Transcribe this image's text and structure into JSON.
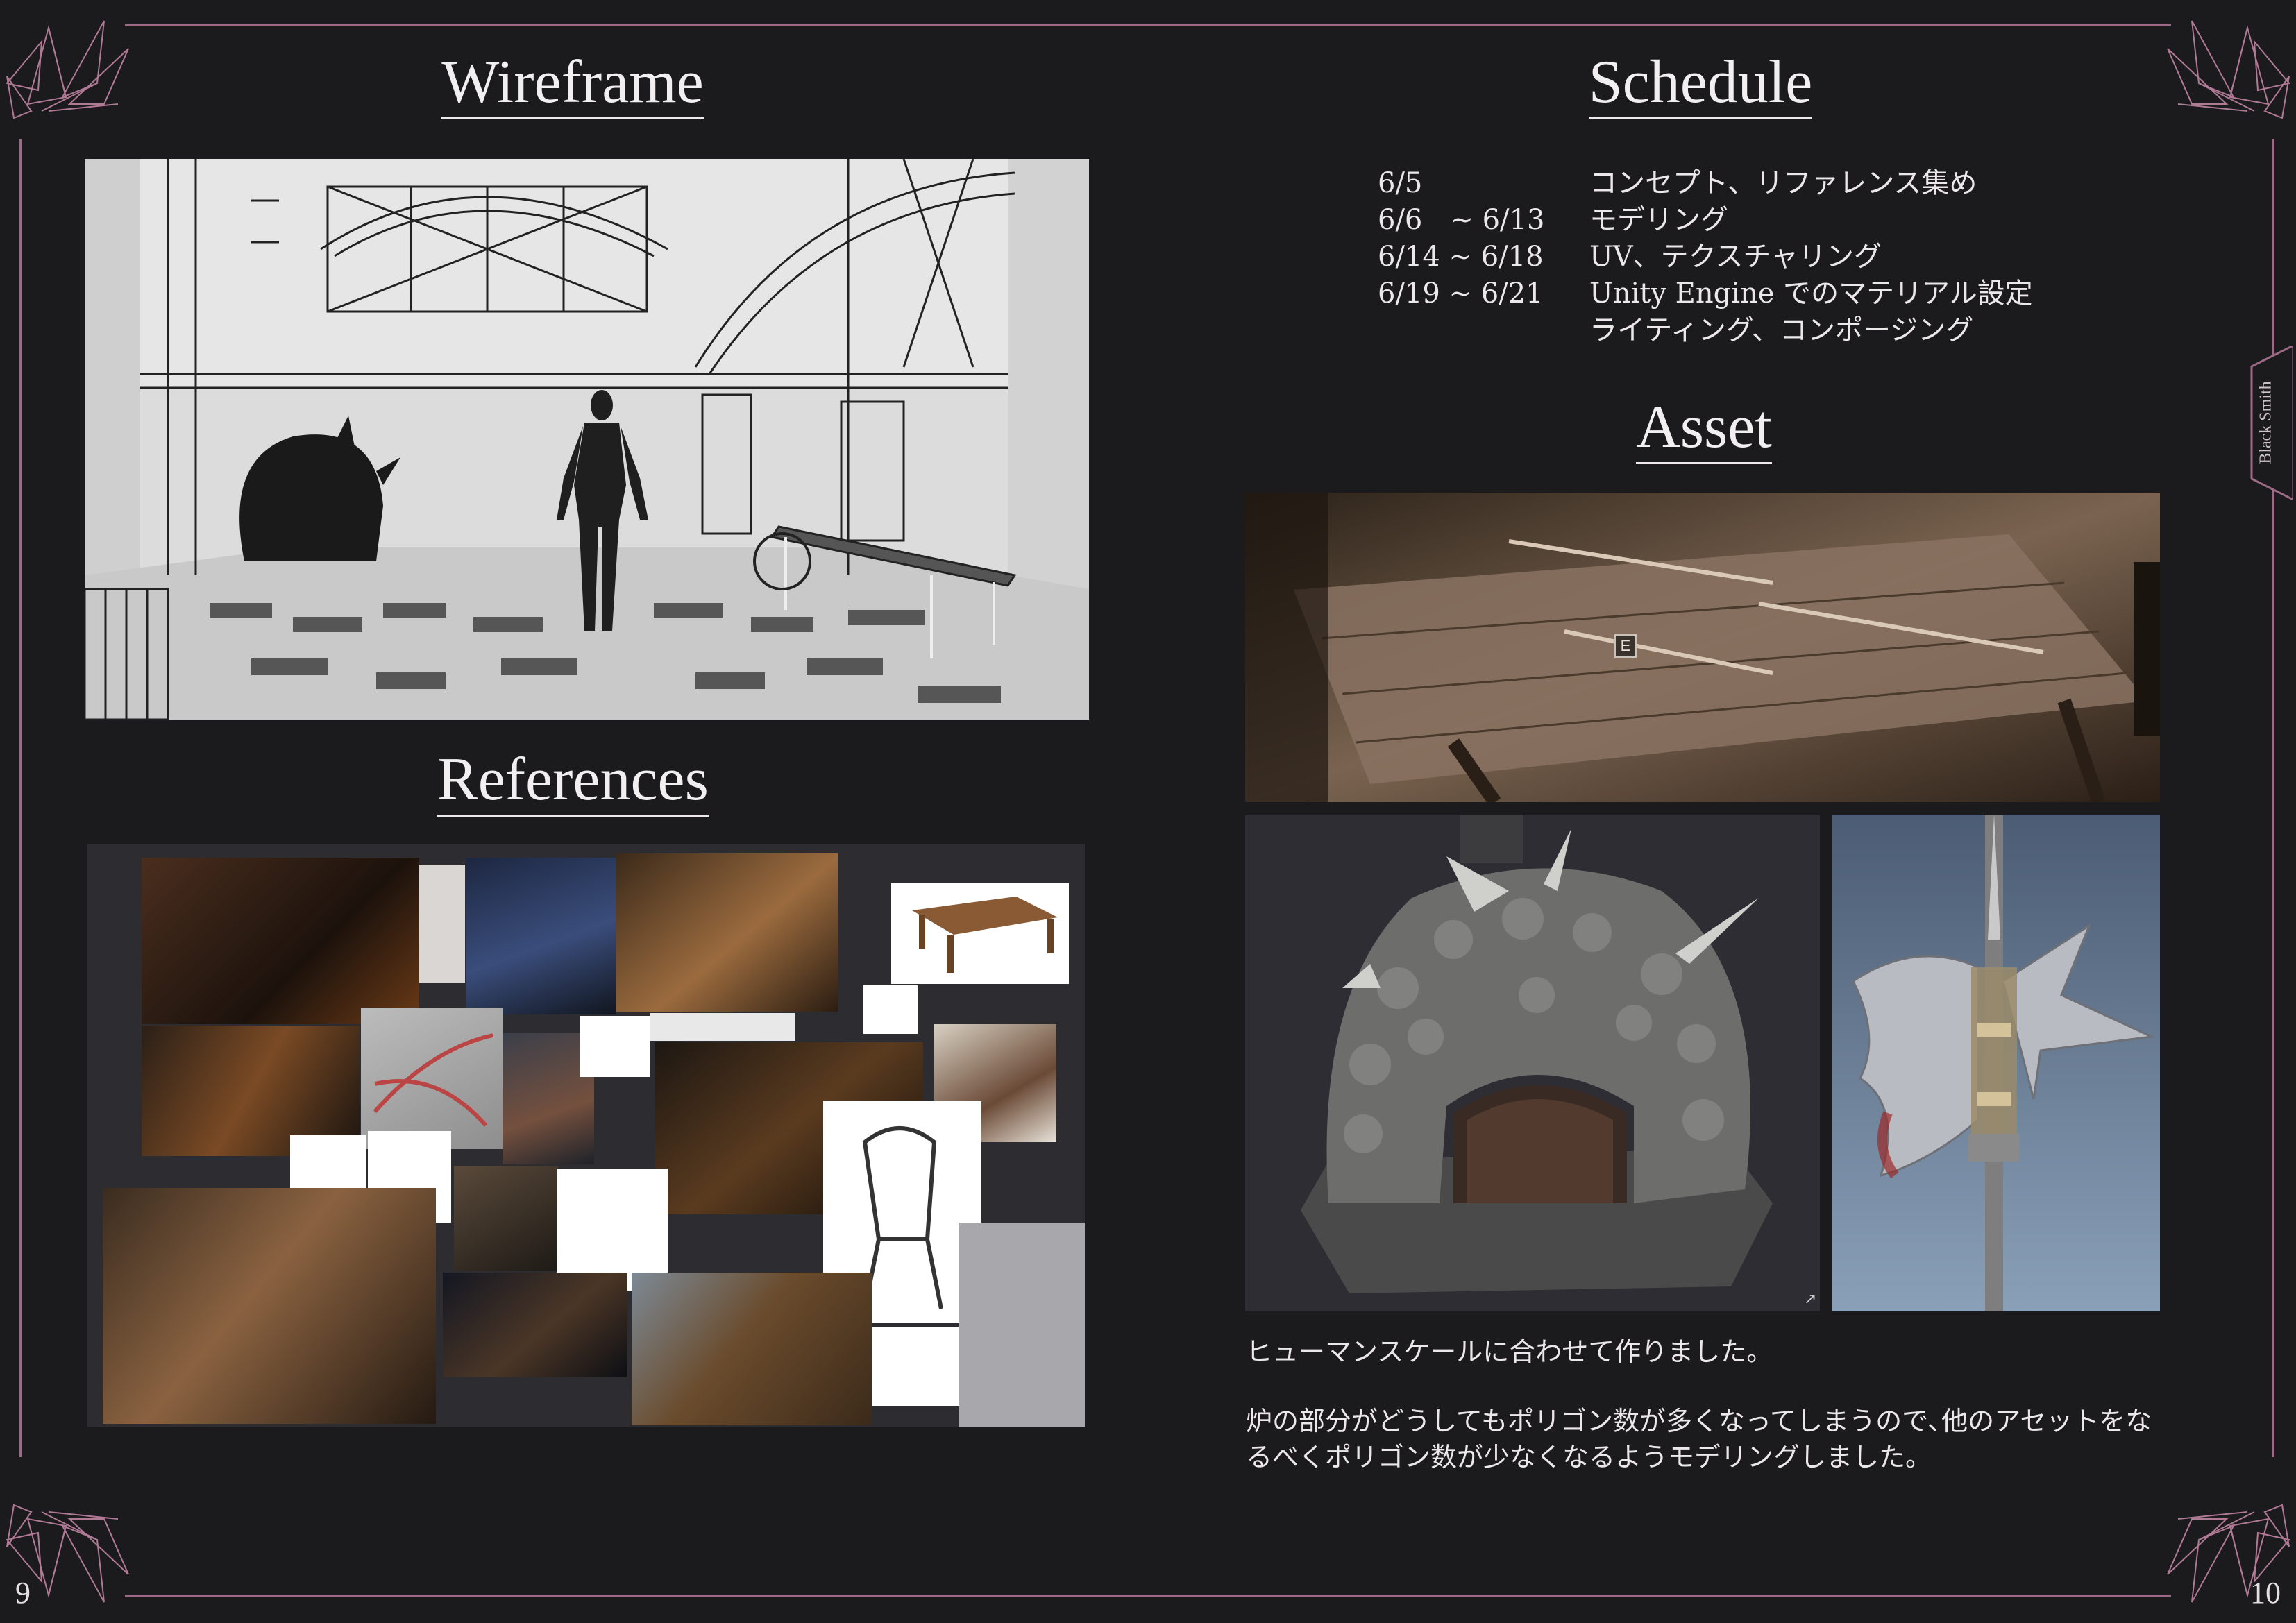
{
  "left_page": {
    "wireframe_title": "Wireframe",
    "references_title": "References",
    "page_number": "9"
  },
  "right_page": {
    "schedule_title": "Schedule",
    "schedule": [
      {
        "date": "6/5",
        "task": "コンセプト、リファレンス集め"
      },
      {
        "date": "6/6　~ 6/13",
        "task": "モデリング"
      },
      {
        "date": "6/14 ~ 6/18",
        "task": "UV、テクスチャリング"
      },
      {
        "date": "6/19 ~ 6/21",
        "task": "Unity Engine でのマテリアル設定"
      },
      {
        "date": "",
        "task": "ライティング、コンポージング"
      }
    ],
    "asset_title": "Asset",
    "caption_line1": "ヒューマンスケールに合わせて作りました。",
    "caption_line2": "炉の部分がどうしてもポリゴン数が多くなってしまうので､他のアセットをなるべくポリゴン数が少なくなるようモデリングしました。",
    "interaction_key": "E",
    "page_number": "10",
    "side_tab": "Black Smith"
  },
  "colors": {
    "background": "#1b1a1c",
    "frame": "#9c6a86",
    "text": "#ece8ea",
    "crystal": "#b07a96"
  }
}
